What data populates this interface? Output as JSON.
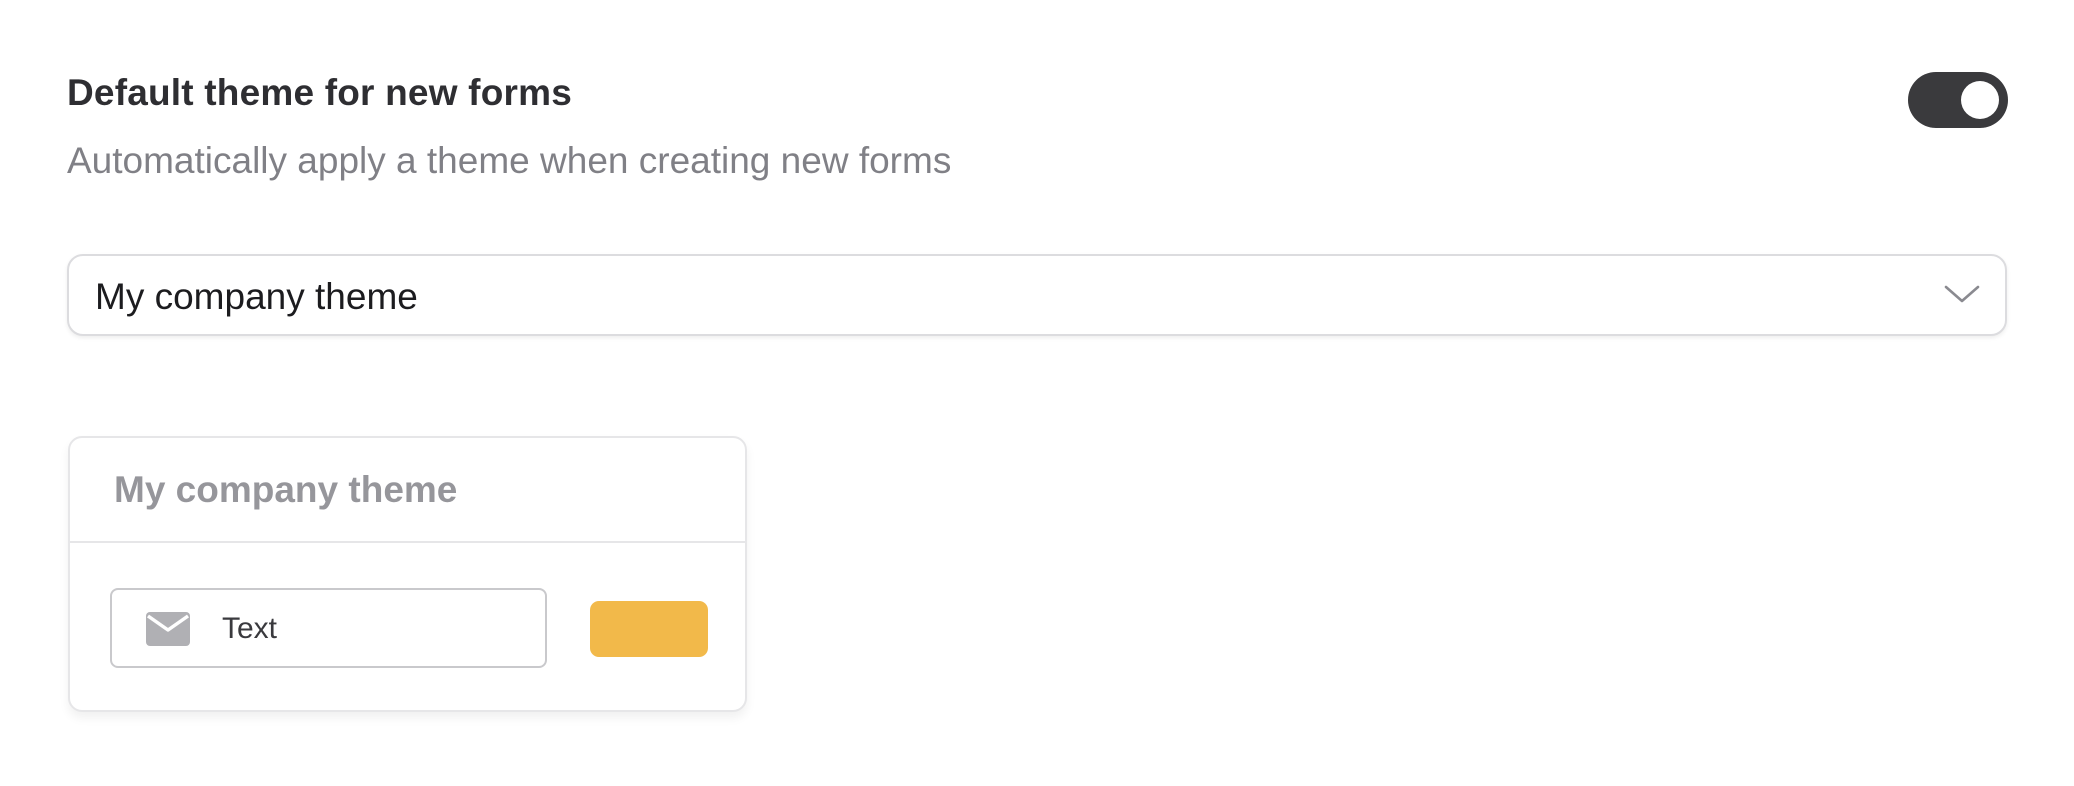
{
  "setting": {
    "title": "Default theme for new forms",
    "description": "Automatically apply a theme when creating new forms",
    "toggle_enabled": true
  },
  "theme_select": {
    "selected": "My company theme"
  },
  "preview_card": {
    "title": "My company theme",
    "input_text": "Text",
    "input_icon": "mail-icon",
    "button_color": "#f2b94a"
  },
  "colors": {
    "toggle_on": "#3a3a3d",
    "accent": "#f2b94a"
  }
}
